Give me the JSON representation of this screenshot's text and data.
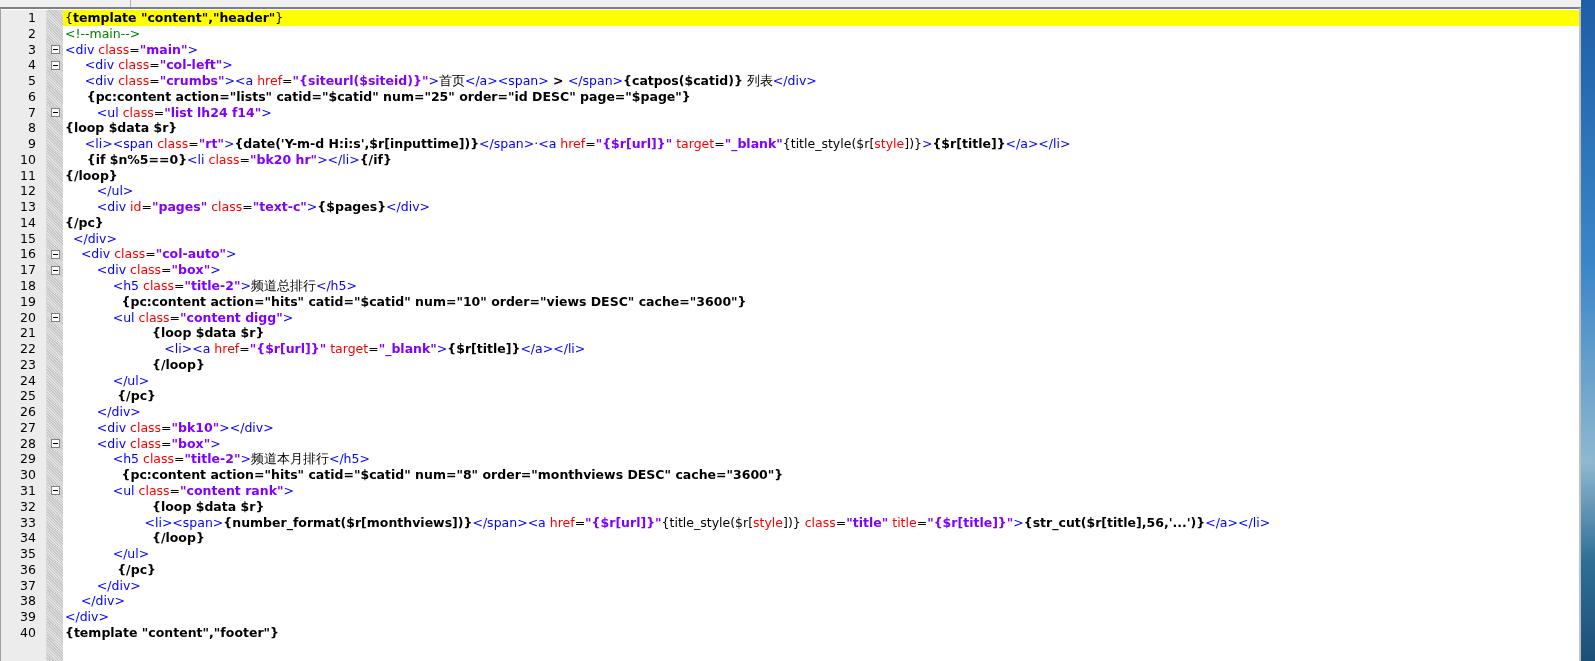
{
  "editor": {
    "lines": [
      {
        "number": "1",
        "current": true,
        "fold": false,
        "tokens": [
          {
            "kind": "text",
            "text": "{"
          },
          {
            "kind": "code",
            "text": "template \"content\",\"header\""
          },
          {
            "kind": "text",
            "text": "}"
          }
        ]
      },
      {
        "number": "2",
        "current": false,
        "fold": false,
        "tokens": [
          {
            "kind": "comment",
            "text": "<!--main-->"
          }
        ]
      },
      {
        "number": "3",
        "current": false,
        "fold": true,
        "tokens": [
          {
            "kind": "tag",
            "text": "<div "
          },
          {
            "kind": "attr",
            "text": "class"
          },
          {
            "kind": "text",
            "text": "="
          },
          {
            "kind": "string",
            "text": "\"main\""
          },
          {
            "kind": "tag",
            "text": ">"
          }
        ]
      },
      {
        "number": "4",
        "current": false,
        "fold": true,
        "tokens": [
          {
            "kind": "tag",
            "text": "     <div "
          },
          {
            "kind": "attr",
            "text": "class"
          },
          {
            "kind": "text",
            "text": "="
          },
          {
            "kind": "string",
            "text": "\"col-left\""
          },
          {
            "kind": "tag",
            "text": ">"
          }
        ]
      },
      {
        "number": "5",
        "current": false,
        "fold": false,
        "tokens": [
          {
            "kind": "tag",
            "text": "     <div "
          },
          {
            "kind": "attr",
            "text": "class"
          },
          {
            "kind": "text",
            "text": "="
          },
          {
            "kind": "string",
            "text": "\"crumbs\""
          },
          {
            "kind": "tag",
            "text": "><a "
          },
          {
            "kind": "attr",
            "text": "href"
          },
          {
            "kind": "text",
            "text": "="
          },
          {
            "kind": "string",
            "text": "\"{siteurl($siteid)}\""
          },
          {
            "kind": "tag",
            "text": ">"
          },
          {
            "kind": "text",
            "text": "首页"
          },
          {
            "kind": "tag",
            "text": "</a><span>"
          },
          {
            "kind": "code",
            "text": " > "
          },
          {
            "kind": "tag",
            "text": "</span>"
          },
          {
            "kind": "code",
            "text": "{catpos($catid)}"
          },
          {
            "kind": "text",
            "text": " 列表"
          },
          {
            "kind": "tag",
            "text": "</div>"
          }
        ]
      },
      {
        "number": "6",
        "current": false,
        "fold": false,
        "tokens": [
          {
            "kind": "code",
            "text": "     {pc:content action=\"lists\" catid=\"$catid\" num=\"25\" order=\"id DESC\" page=\"$page\"}"
          }
        ]
      },
      {
        "number": "7",
        "current": false,
        "fold": true,
        "tokens": [
          {
            "kind": "tag",
            "text": "        <ul "
          },
          {
            "kind": "attr",
            "text": "class"
          },
          {
            "kind": "text",
            "text": "="
          },
          {
            "kind": "string",
            "text": "\"list lh24 f14\""
          },
          {
            "kind": "tag",
            "text": ">"
          }
        ]
      },
      {
        "number": "8",
        "current": false,
        "fold": false,
        "tokens": [
          {
            "kind": "code",
            "text": "{loop $data $r}"
          }
        ]
      },
      {
        "number": "9",
        "current": false,
        "fold": false,
        "tokens": [
          {
            "kind": "tag",
            "text": "     <li><span "
          },
          {
            "kind": "attr",
            "text": "class"
          },
          {
            "kind": "text",
            "text": "="
          },
          {
            "kind": "string",
            "text": "\"rt\""
          },
          {
            "kind": "tag",
            "text": ">"
          },
          {
            "kind": "code",
            "text": "{date('Y-m-d H:i:s',$r[inputtime])}"
          },
          {
            "kind": "tag",
            "text": "</span>·<a "
          },
          {
            "kind": "attr",
            "text": "href"
          },
          {
            "kind": "text",
            "text": "="
          },
          {
            "kind": "string",
            "text": "\"{$r[url]}\""
          },
          {
            "kind": "attr",
            "text": " target"
          },
          {
            "kind": "text",
            "text": "="
          },
          {
            "kind": "string",
            "text": "\"_blank\""
          },
          {
            "kind": "text",
            "text": "{title_style($r["
          },
          {
            "kind": "attr",
            "text": "style"
          },
          {
            "kind": "text",
            "text": "])}"
          },
          {
            "kind": "tag",
            "text": ">"
          },
          {
            "kind": "code",
            "text": "{$r[title]}"
          },
          {
            "kind": "tag",
            "text": "</a></li>"
          }
        ]
      },
      {
        "number": "10",
        "current": false,
        "fold": false,
        "tokens": [
          {
            "kind": "code",
            "text": "     {if $n%5==0}"
          },
          {
            "kind": "tag",
            "text": "<li "
          },
          {
            "kind": "attr",
            "text": "class"
          },
          {
            "kind": "text",
            "text": "="
          },
          {
            "kind": "string",
            "text": "\"bk20 hr\""
          },
          {
            "kind": "tag",
            "text": "></li>"
          },
          {
            "kind": "code",
            "text": "{/if}"
          }
        ]
      },
      {
        "number": "11",
        "current": false,
        "fold": false,
        "tokens": [
          {
            "kind": "code",
            "text": "{/loop}"
          }
        ]
      },
      {
        "number": "12",
        "current": false,
        "fold": false,
        "tokens": [
          {
            "kind": "tag",
            "text": "        </ul>"
          }
        ]
      },
      {
        "number": "13",
        "current": false,
        "fold": false,
        "tokens": [
          {
            "kind": "tag",
            "text": "        <div "
          },
          {
            "kind": "attr",
            "text": "id"
          },
          {
            "kind": "text",
            "text": "="
          },
          {
            "kind": "string",
            "text": "\"pages\""
          },
          {
            "kind": "attr",
            "text": " class"
          },
          {
            "kind": "text",
            "text": "="
          },
          {
            "kind": "string",
            "text": "\"text-c\""
          },
          {
            "kind": "tag",
            "text": ">"
          },
          {
            "kind": "code",
            "text": "{$pages}"
          },
          {
            "kind": "tag",
            "text": "</div>"
          }
        ]
      },
      {
        "number": "14",
        "current": false,
        "fold": false,
        "tokens": [
          {
            "kind": "code",
            "text": "{/pc}"
          }
        ]
      },
      {
        "number": "15",
        "current": false,
        "fold": false,
        "tokens": [
          {
            "kind": "tag",
            "text": "  </div>"
          }
        ]
      },
      {
        "number": "16",
        "current": false,
        "fold": true,
        "tokens": [
          {
            "kind": "tag",
            "text": "    <div "
          },
          {
            "kind": "attr",
            "text": "class"
          },
          {
            "kind": "text",
            "text": "="
          },
          {
            "kind": "string",
            "text": "\"col-auto\""
          },
          {
            "kind": "tag",
            "text": ">"
          }
        ]
      },
      {
        "number": "17",
        "current": false,
        "fold": true,
        "tokens": [
          {
            "kind": "tag",
            "text": "        <div "
          },
          {
            "kind": "attr",
            "text": "class"
          },
          {
            "kind": "text",
            "text": "="
          },
          {
            "kind": "string",
            "text": "\"box\""
          },
          {
            "kind": "tag",
            "text": ">"
          }
        ]
      },
      {
        "number": "18",
        "current": false,
        "fold": false,
        "tokens": [
          {
            "kind": "tag",
            "text": "            <h5 "
          },
          {
            "kind": "attr",
            "text": "class"
          },
          {
            "kind": "text",
            "text": "="
          },
          {
            "kind": "string",
            "text": "\"title-2\""
          },
          {
            "kind": "tag",
            "text": ">"
          },
          {
            "kind": "text",
            "text": "频道总排行"
          },
          {
            "kind": "tag",
            "text": "</h5>"
          }
        ]
      },
      {
        "number": "19",
        "current": false,
        "fold": false,
        "tokens": [
          {
            "kind": "code",
            "text": "             {pc:content action=\"hits\" catid=\"$catid\" num=\"10\" order=\"views DESC\" cache=\"3600\"}"
          }
        ]
      },
      {
        "number": "20",
        "current": false,
        "fold": true,
        "tokens": [
          {
            "kind": "tag",
            "text": "            <ul "
          },
          {
            "kind": "attr",
            "text": "class"
          },
          {
            "kind": "text",
            "text": "="
          },
          {
            "kind": "string",
            "text": "\"content digg\""
          },
          {
            "kind": "tag",
            "text": ">"
          }
        ]
      },
      {
        "number": "21",
        "current": false,
        "fold": false,
        "tokens": [
          {
            "kind": "code",
            "text": "                    {loop $data $r}"
          }
        ]
      },
      {
        "number": "22",
        "current": false,
        "fold": false,
        "tokens": [
          {
            "kind": "tag",
            "text": "                         <li><a "
          },
          {
            "kind": "attr",
            "text": "href"
          },
          {
            "kind": "text",
            "text": "="
          },
          {
            "kind": "string",
            "text": "\"{$r[url]}\""
          },
          {
            "kind": "attr",
            "text": " target"
          },
          {
            "kind": "text",
            "text": "="
          },
          {
            "kind": "string",
            "text": "\"_blank\""
          },
          {
            "kind": "tag",
            "text": ">"
          },
          {
            "kind": "code",
            "text": "{$r[title]}"
          },
          {
            "kind": "tag",
            "text": "</a></li>"
          }
        ]
      },
      {
        "number": "23",
        "current": false,
        "fold": false,
        "tokens": [
          {
            "kind": "code",
            "text": "                    {/loop}"
          }
        ]
      },
      {
        "number": "24",
        "current": false,
        "fold": false,
        "tokens": [
          {
            "kind": "tag",
            "text": "            </ul>"
          }
        ]
      },
      {
        "number": "25",
        "current": false,
        "fold": false,
        "tokens": [
          {
            "kind": "code",
            "text": "            {/pc}"
          }
        ]
      },
      {
        "number": "26",
        "current": false,
        "fold": false,
        "tokens": [
          {
            "kind": "tag",
            "text": "        </div>"
          }
        ]
      },
      {
        "number": "27",
        "current": false,
        "fold": false,
        "tokens": [
          {
            "kind": "tag",
            "text": "        <div "
          },
          {
            "kind": "attr",
            "text": "class"
          },
          {
            "kind": "text",
            "text": "="
          },
          {
            "kind": "string",
            "text": "\"bk10\""
          },
          {
            "kind": "tag",
            "text": "></div>"
          }
        ]
      },
      {
        "number": "28",
        "current": false,
        "fold": true,
        "tokens": [
          {
            "kind": "tag",
            "text": "        <div "
          },
          {
            "kind": "attr",
            "text": "class"
          },
          {
            "kind": "text",
            "text": "="
          },
          {
            "kind": "string",
            "text": "\"box\""
          },
          {
            "kind": "tag",
            "text": ">"
          }
        ]
      },
      {
        "number": "29",
        "current": false,
        "fold": false,
        "tokens": [
          {
            "kind": "tag",
            "text": "            <h5 "
          },
          {
            "kind": "attr",
            "text": "class"
          },
          {
            "kind": "text",
            "text": "="
          },
          {
            "kind": "string",
            "text": "\"title-2\""
          },
          {
            "kind": "tag",
            "text": ">"
          },
          {
            "kind": "text",
            "text": "频道本月排行"
          },
          {
            "kind": "tag",
            "text": "</h5>"
          }
        ]
      },
      {
        "number": "30",
        "current": false,
        "fold": false,
        "tokens": [
          {
            "kind": "code",
            "text": "             {pc:content action=\"hits\" catid=\"$catid\" num=\"8\" order=\"monthviews DESC\" cache=\"3600\"}"
          }
        ]
      },
      {
        "number": "31",
        "current": false,
        "fold": true,
        "tokens": [
          {
            "kind": "tag",
            "text": "            <ul "
          },
          {
            "kind": "attr",
            "text": "class"
          },
          {
            "kind": "text",
            "text": "="
          },
          {
            "kind": "string",
            "text": "\"content rank\""
          },
          {
            "kind": "tag",
            "text": ">"
          }
        ]
      },
      {
        "number": "32",
        "current": false,
        "fold": false,
        "tokens": [
          {
            "kind": "code",
            "text": "                    {loop $data $r}"
          }
        ]
      },
      {
        "number": "33",
        "current": false,
        "fold": false,
        "tokens": [
          {
            "kind": "tag",
            "text": "                    <li><span>"
          },
          {
            "kind": "code",
            "text": "{number_format($r[monthviews])}"
          },
          {
            "kind": "tag",
            "text": "</span><a "
          },
          {
            "kind": "attr",
            "text": "href"
          },
          {
            "kind": "text",
            "text": "="
          },
          {
            "kind": "string",
            "text": "\"{$r[url]}\""
          },
          {
            "kind": "text",
            "text": "{title_style($r["
          },
          {
            "kind": "attr",
            "text": "style"
          },
          {
            "kind": "text",
            "text": "])} "
          },
          {
            "kind": "attr",
            "text": "class"
          },
          {
            "kind": "text",
            "text": "="
          },
          {
            "kind": "string",
            "text": "\"title\""
          },
          {
            "kind": "attr",
            "text": " title"
          },
          {
            "kind": "text",
            "text": "="
          },
          {
            "kind": "string",
            "text": "\"{$r[title]}\""
          },
          {
            "kind": "tag",
            "text": ">"
          },
          {
            "kind": "code",
            "text": "{str_cut($r[title],56,'...')}"
          },
          {
            "kind": "tag",
            "text": "</a></li>"
          }
        ]
      },
      {
        "number": "34",
        "current": false,
        "fold": false,
        "tokens": [
          {
            "kind": "code",
            "text": "                    {/loop}"
          }
        ]
      },
      {
        "number": "35",
        "current": false,
        "fold": false,
        "tokens": [
          {
            "kind": "tag",
            "text": "            </ul>"
          }
        ]
      },
      {
        "number": "36",
        "current": false,
        "fold": false,
        "tokens": [
          {
            "kind": "code",
            "text": "            {/pc}"
          }
        ]
      },
      {
        "number": "37",
        "current": false,
        "fold": false,
        "tokens": [
          {
            "kind": "tag",
            "text": "        </div>"
          }
        ]
      },
      {
        "number": "38",
        "current": false,
        "fold": false,
        "tokens": [
          {
            "kind": "tag",
            "text": "    </div>"
          }
        ]
      },
      {
        "number": "39",
        "current": false,
        "fold": false,
        "tokens": [
          {
            "kind": "tag",
            "text": "</div>"
          }
        ]
      },
      {
        "number": "40",
        "current": false,
        "fold": false,
        "tokens": [
          {
            "kind": "code",
            "text": "{template \"content\",\"footer\"}"
          }
        ]
      }
    ]
  }
}
